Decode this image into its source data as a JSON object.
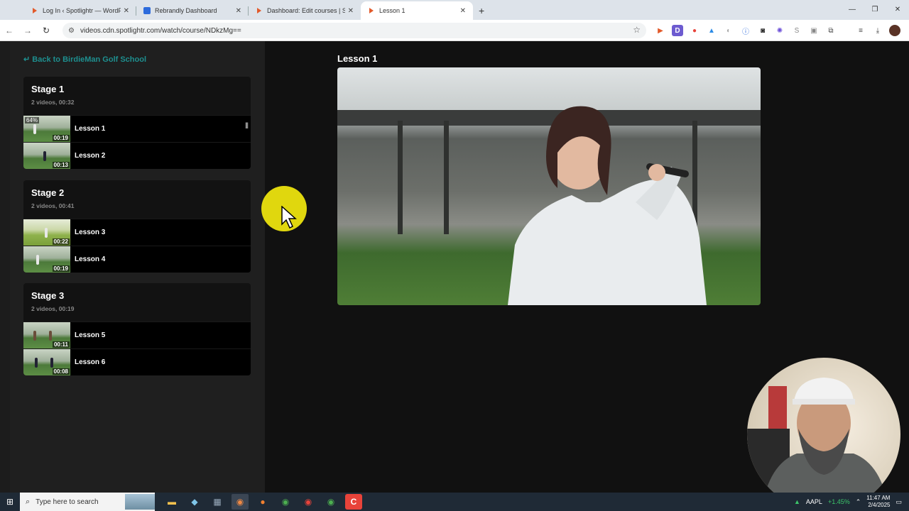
{
  "browser": {
    "tabs": [
      {
        "title": "Log In ‹ Spotlightr — WordPress",
        "favicon_color": "#e25a2b",
        "active": false
      },
      {
        "title": "Rebrandly Dashboard",
        "favicon_color": "#2d6bdc",
        "active": false
      },
      {
        "title": "Dashboard: Edit courses | Spotlightr",
        "favicon_color": "#e25a2b",
        "active": false
      },
      {
        "title": "Lesson 1",
        "favicon_color": "#e25a2b",
        "active": true
      }
    ],
    "new_tab": "+",
    "url": "videos.cdn.spotlightr.com/watch/course/NDkzMg=="
  },
  "page": {
    "back_link": "↵ Back to BirdieMan Golf School",
    "accent_color": "#1e8f8f",
    "stages": [
      {
        "title": "Stage 1",
        "meta": "2 videos, 00:32",
        "lessons": [
          {
            "name": "Lesson 1",
            "duration": "00:19",
            "progress": "64%",
            "playing": true
          },
          {
            "name": "Lesson 2",
            "duration": "00:13"
          }
        ]
      },
      {
        "title": "Stage 2",
        "meta": "2 videos, 00:41",
        "lessons": [
          {
            "name": "Lesson 3",
            "duration": "00:22"
          },
          {
            "name": "Lesson 4",
            "duration": "00:19"
          }
        ]
      },
      {
        "title": "Stage 3",
        "meta": "2 videos, 00:19",
        "lessons": [
          {
            "name": "Lesson 5",
            "duration": "00:11"
          },
          {
            "name": "Lesson 6",
            "duration": "00:08"
          }
        ]
      }
    ],
    "video_title": "Lesson 1"
  },
  "taskbar": {
    "search_placeholder": "Type here to search",
    "stock_ticker": "AAPL",
    "stock_change": "+1.45%",
    "time": "11:47 AM",
    "date": "2/4/2025"
  }
}
